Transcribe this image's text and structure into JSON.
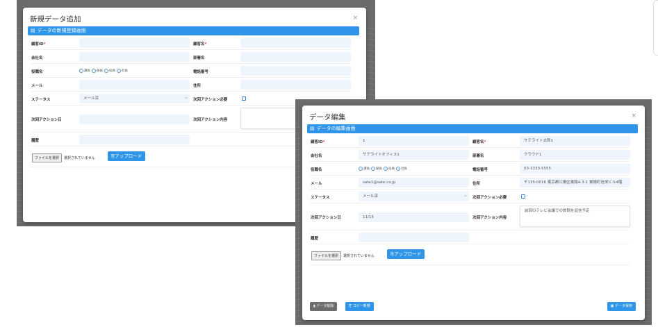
{
  "new_modal": {
    "title": "新規データ追加",
    "close": "×",
    "section": "データの新規登録画面",
    "fields": {
      "customer_id": {
        "label": "顧客ID",
        "value": ""
      },
      "customer_name": {
        "label": "顧客名",
        "value": ""
      },
      "company": {
        "label": "会社名",
        "value": ""
      },
      "department": {
        "label": "部署名",
        "value": ""
      },
      "position": {
        "label": "役職名",
        "options": [
          "課長",
          "部長",
          "役員",
          "社長"
        ]
      },
      "phone": {
        "label": "電話番号",
        "value": ""
      },
      "email": {
        "label": "メール",
        "value": ""
      },
      "address": {
        "label": "住所",
        "value": ""
      },
      "status": {
        "label": "ステータス",
        "value": "メール済"
      },
      "action_required": {
        "label": "次回アクション必要",
        "checked": false
      },
      "action_date": {
        "label": "次回アクション日",
        "value": ""
      },
      "action_content": {
        "label": "次回アクション内容",
        "value": ""
      },
      "history": {
        "label": "履歴",
        "value": ""
      }
    },
    "file_button": "ファイルを選択",
    "file_status": "選択されていません",
    "upload": "アップロード"
  },
  "edit_modal": {
    "title": "データ編集",
    "close": "×",
    "section": "データの編集画面",
    "fields": {
      "customer_id": {
        "label": "顧客ID",
        "value": "1"
      },
      "customer_name": {
        "label": "顧客名",
        "value": "サテライト太郎1"
      },
      "company": {
        "label": "会社名",
        "value": "サテライトオフィス1"
      },
      "department": {
        "label": "部署名",
        "value": "クラウド1"
      },
      "position": {
        "label": "役職名",
        "options": [
          "課長",
          "部長",
          "役員",
          "社長"
        ]
      },
      "phone": {
        "label": "電話番号",
        "value": "03-3333-5555"
      },
      "email": {
        "label": "メール",
        "value": "sate1@sate.co.jp"
      },
      "address": {
        "label": "住所",
        "value": "〒135-0016 東京都江東区東陽4-3-1 東陽町信栄ビル4階"
      },
      "status": {
        "label": "ステータス",
        "value": "メール済"
      },
      "action_required": {
        "label": "次回アクション必要",
        "checked": false
      },
      "action_date": {
        "label": "次回アクション日",
        "value": "11/15"
      },
      "action_content": {
        "label": "次回アクション内容",
        "value": "前回のテレビ会議での質問を返信予定"
      },
      "history": {
        "label": "履歴",
        "value": ""
      }
    },
    "file_button": "ファイルを選択",
    "file_status": "選択されていません",
    "upload": "アップロード",
    "delete": "データ削除",
    "copy": "コピー新規",
    "save": "データ保存"
  },
  "colors": {
    "primary": "#2f95e8",
    "delete": "#6c6c6c",
    "overlay": "#6b6b6b"
  }
}
